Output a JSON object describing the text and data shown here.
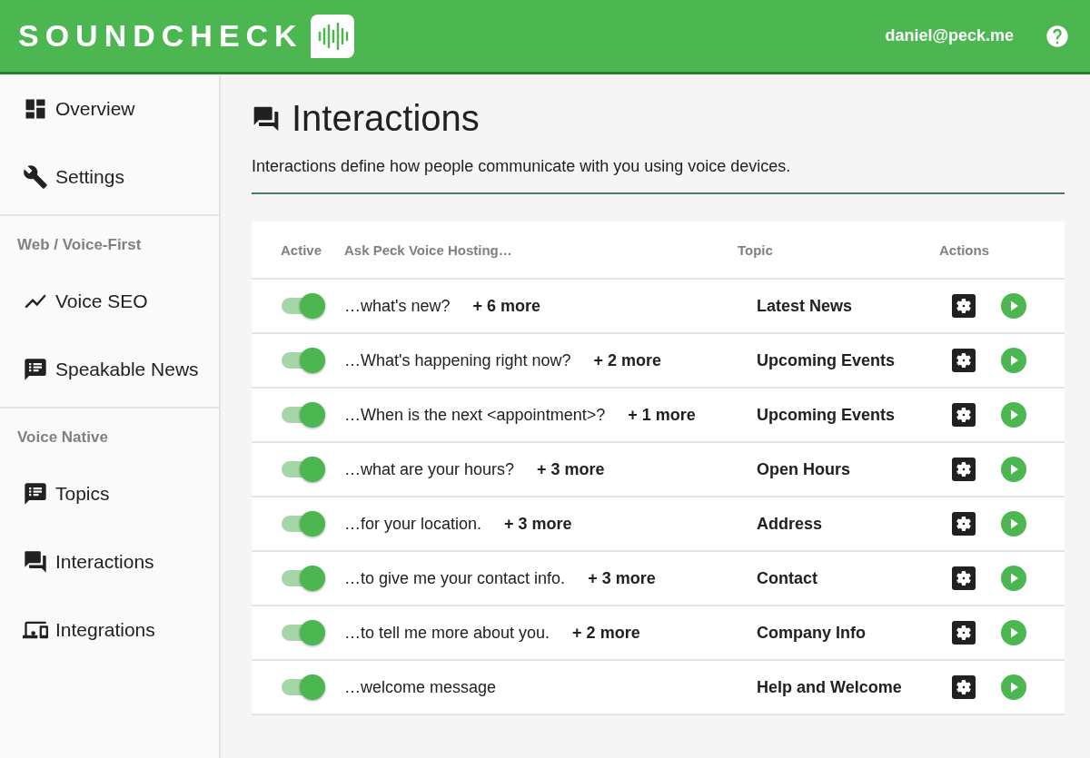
{
  "header": {
    "logo": "SOUNDCHECK",
    "user": "daniel@peck.me"
  },
  "sidebar": {
    "sections": [
      {
        "items": [
          {
            "label": "Overview"
          },
          {
            "label": "Settings"
          }
        ]
      },
      {
        "title": "Web / Voice-First",
        "items": [
          {
            "label": "Voice SEO"
          },
          {
            "label": "Speakable News"
          }
        ]
      },
      {
        "title": "Voice Native",
        "items": [
          {
            "label": "Topics"
          },
          {
            "label": "Interactions"
          },
          {
            "label": "Integrations"
          }
        ]
      }
    ]
  },
  "page": {
    "title": "Interactions",
    "description": "Interactions define how people communicate with you using voice devices."
  },
  "table": {
    "columns": [
      "Active",
      "Ask Peck Voice Hosting…",
      "Topic",
      "Actions"
    ],
    "rows": [
      {
        "active": true,
        "phrase": "…what's new?",
        "more": "+ 6 more",
        "topic": "Latest News"
      },
      {
        "active": true,
        "phrase": "…What's happening right now?",
        "more": "+ 2 more",
        "topic": "Upcoming Events"
      },
      {
        "active": true,
        "phrase": "…When is the next <appointment>?",
        "more": "+ 1 more",
        "topic": "Upcoming Events"
      },
      {
        "active": true,
        "phrase": "…what are your hours?",
        "more": "+ 3 more",
        "topic": "Open Hours"
      },
      {
        "active": true,
        "phrase": "…for your location.",
        "more": "+ 3 more",
        "topic": "Address"
      },
      {
        "active": true,
        "phrase": "…to give me your contact info.",
        "more": "+ 3 more",
        "topic": "Contact"
      },
      {
        "active": true,
        "phrase": "…to tell me more about you.",
        "more": "+ 2 more",
        "topic": "Company Info"
      },
      {
        "active": true,
        "phrase": "…welcome message",
        "topic": "Help and Welcome"
      }
    ]
  }
}
